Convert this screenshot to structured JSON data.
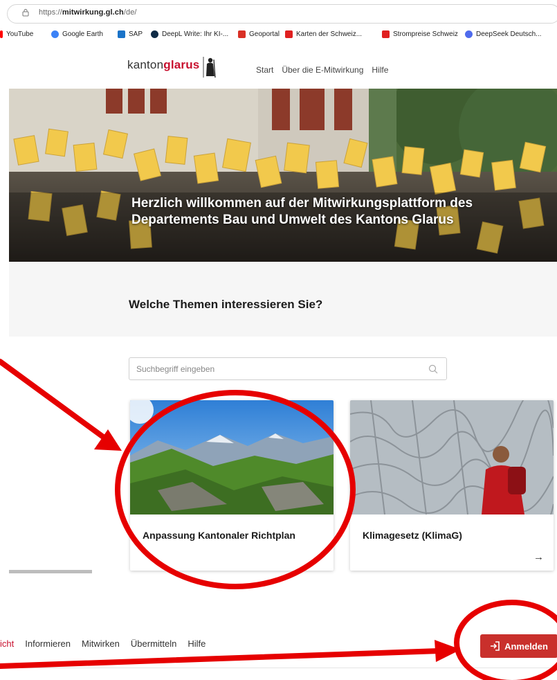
{
  "browser": {
    "url_prefix": "https://",
    "url_domain": "mitwirkung.gl.ch",
    "url_path": "/de/",
    "bookmarks": [
      {
        "label": "YouTube",
        "color": "#ff0000"
      },
      {
        "label": "Google Earth",
        "color": "#3b82f6"
      },
      {
        "label": "SAP",
        "color": "#1a73c8"
      },
      {
        "label": "DeepL Write: Ihr KI-...",
        "color": "#0f2b46"
      },
      {
        "label": "Geoportal",
        "color": "#d93025"
      },
      {
        "label": "Karten der Schweiz...",
        "color": "#e02020"
      },
      {
        "label": "Strompreise Schweiz",
        "color": "#e02020"
      },
      {
        "label": "DeepSeek Deutsch...",
        "color": "#4f6bed"
      }
    ]
  },
  "header": {
    "logo_part1": "kanton",
    "logo_part2": "glarus",
    "nav": [
      "Start",
      "Über die E-Mitwirkung",
      "Hilfe"
    ]
  },
  "hero": {
    "title_line1": "Herzlich willkommen auf der Mitwirkungsplattform des",
    "title_line2": "Departements Bau und Umwelt des Kantons Glarus"
  },
  "topics": {
    "heading": "Welche Themen interessieren Sie?",
    "search_placeholder": "Suchbegriff eingeben"
  },
  "cards": [
    {
      "title": "Anpassung Kantonaler Richtplan",
      "arrow": "→"
    },
    {
      "title": "Klimagesetz (KlimaG)",
      "arrow": "→"
    }
  ],
  "bottom_nav": {
    "items": [
      "icht",
      "Informieren",
      "Mitwirken",
      "Übermitteln",
      "Hilfe"
    ],
    "login_label": "Anmelden"
  },
  "colors": {
    "brand_red": "#c8102e",
    "annotation_red": "#e60000",
    "login_button": "#c9302c"
  }
}
